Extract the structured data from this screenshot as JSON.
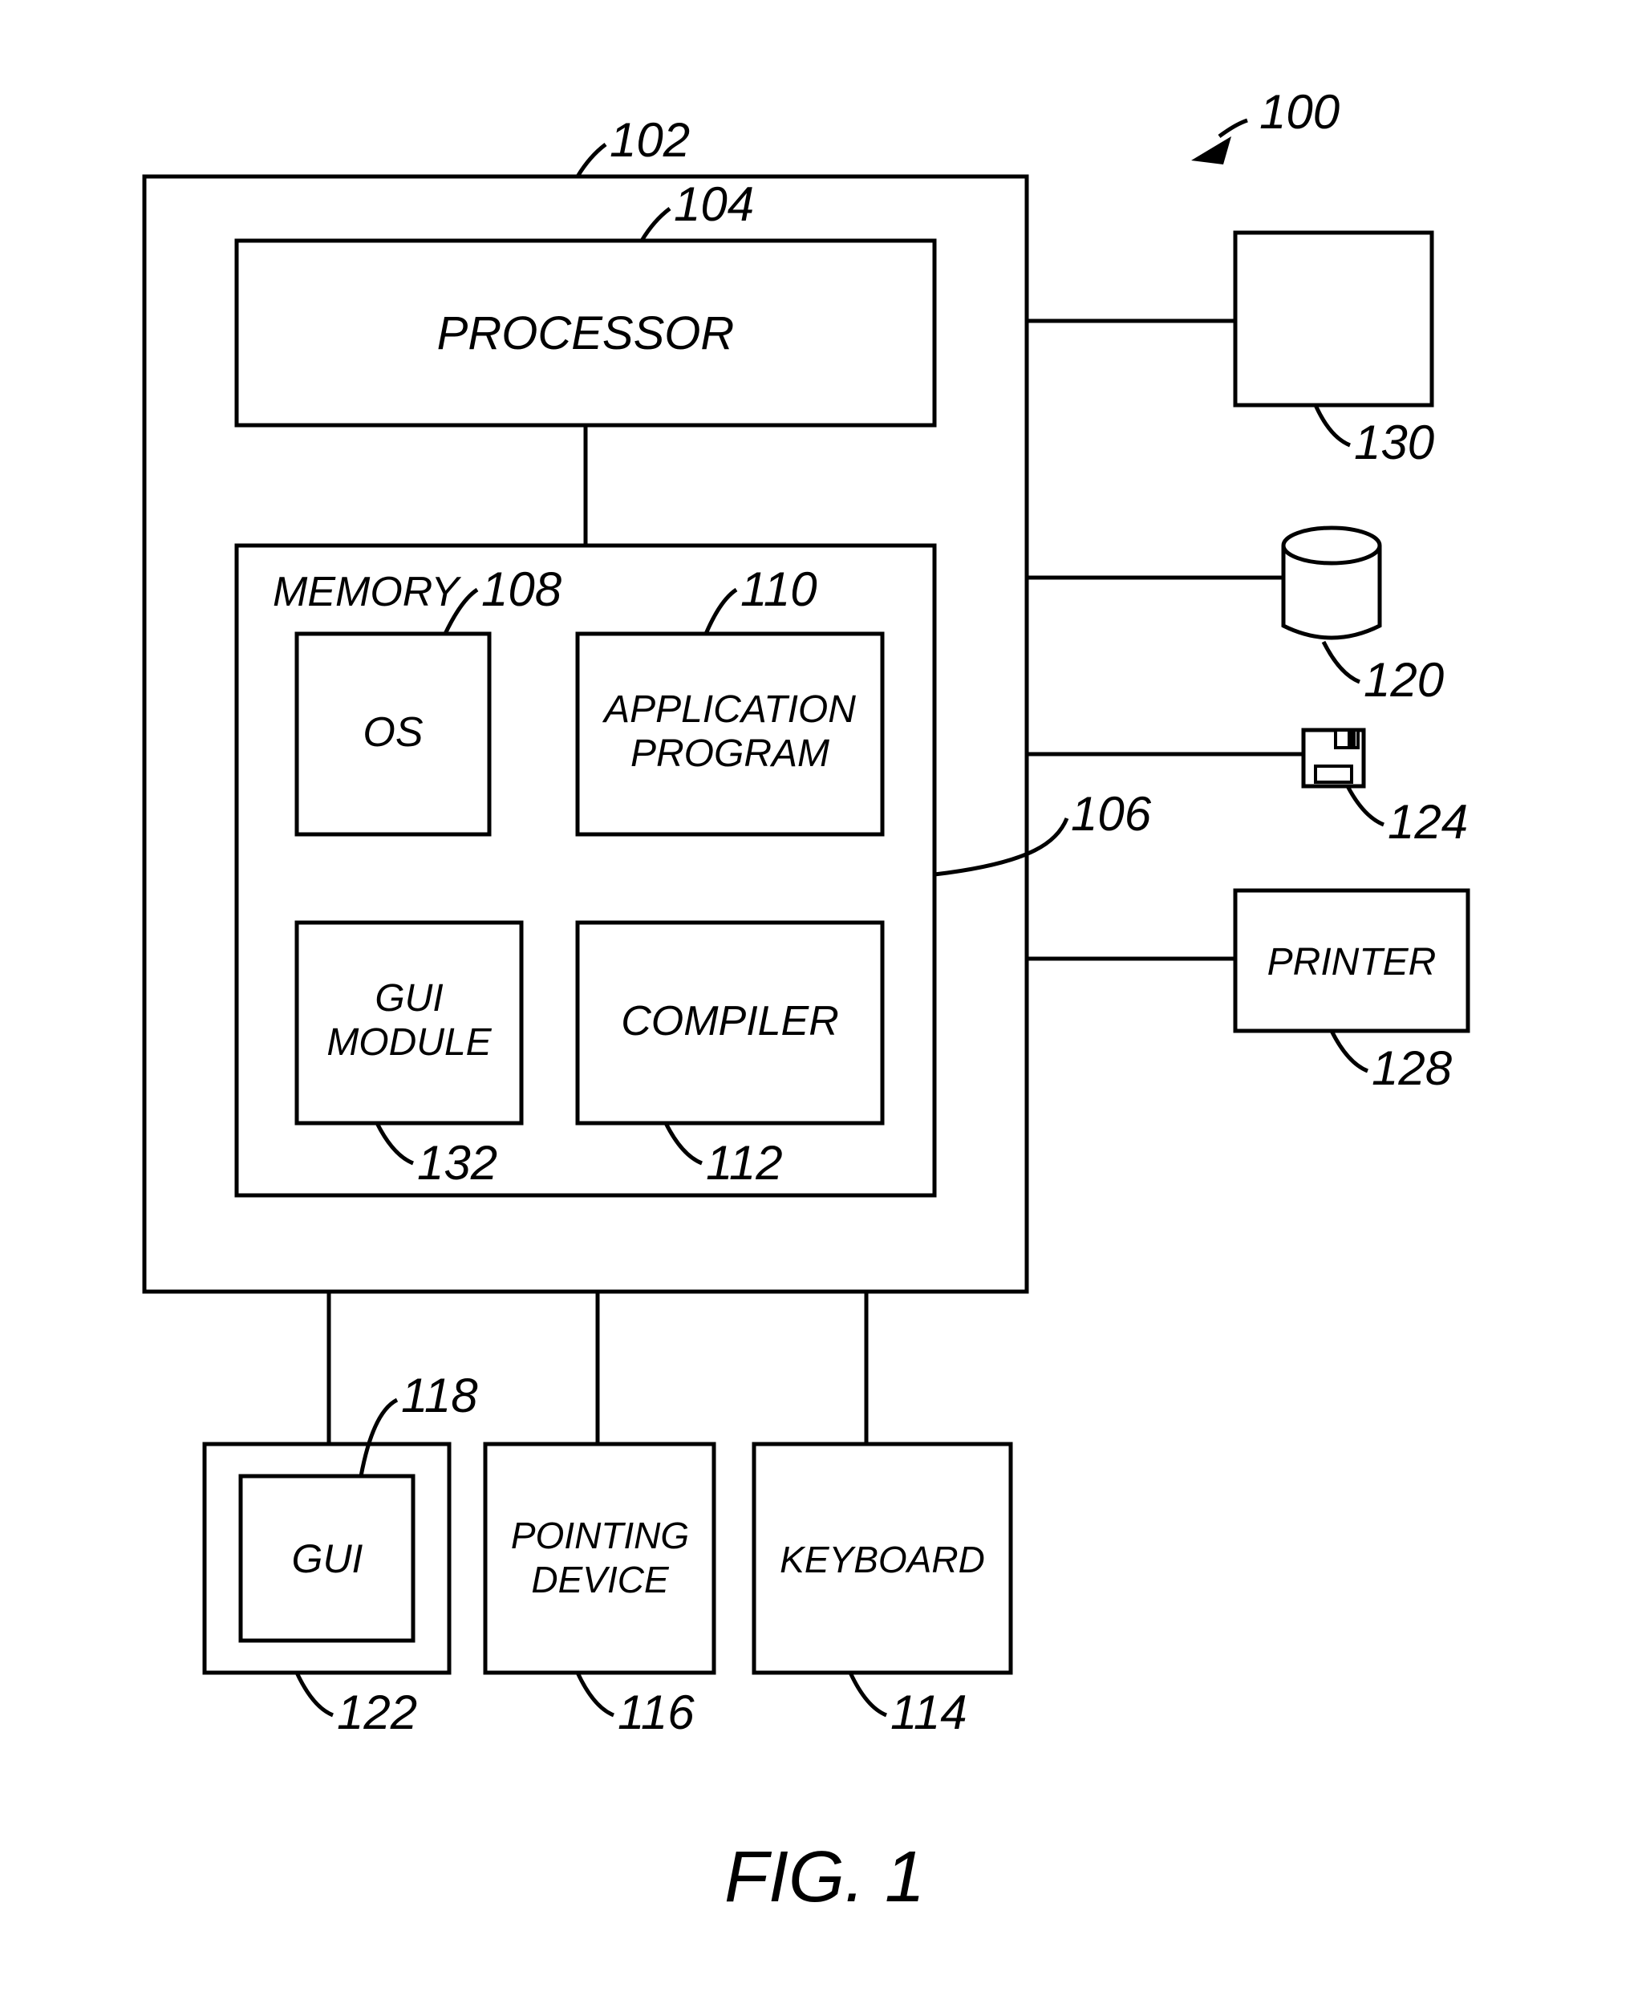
{
  "figure": {
    "caption": "FIG. 1",
    "refs": {
      "system": "100",
      "computer": "102",
      "processor": "104",
      "memory": "106",
      "os": "108",
      "app": "110",
      "compiler": "112",
      "keyboard": "114",
      "pointing": "116",
      "gui_inner": "118",
      "cylinder": "120",
      "display": "122",
      "disk": "124",
      "printer": "128",
      "monitor": "130",
      "gui_module": "132"
    },
    "labels": {
      "processor": "PROCESSOR",
      "memory": "MEMORY",
      "os": "OS",
      "app_line1": "APPLICATION",
      "app_line2": "PROGRAM",
      "gui_module_line1": "GUI",
      "gui_module_line2": "MODULE",
      "compiler": "COMPILER",
      "gui": "GUI",
      "pointing_line1": "POINTING",
      "pointing_line2": "DEVICE",
      "keyboard": "KEYBOARD",
      "printer": "PRINTER"
    }
  }
}
